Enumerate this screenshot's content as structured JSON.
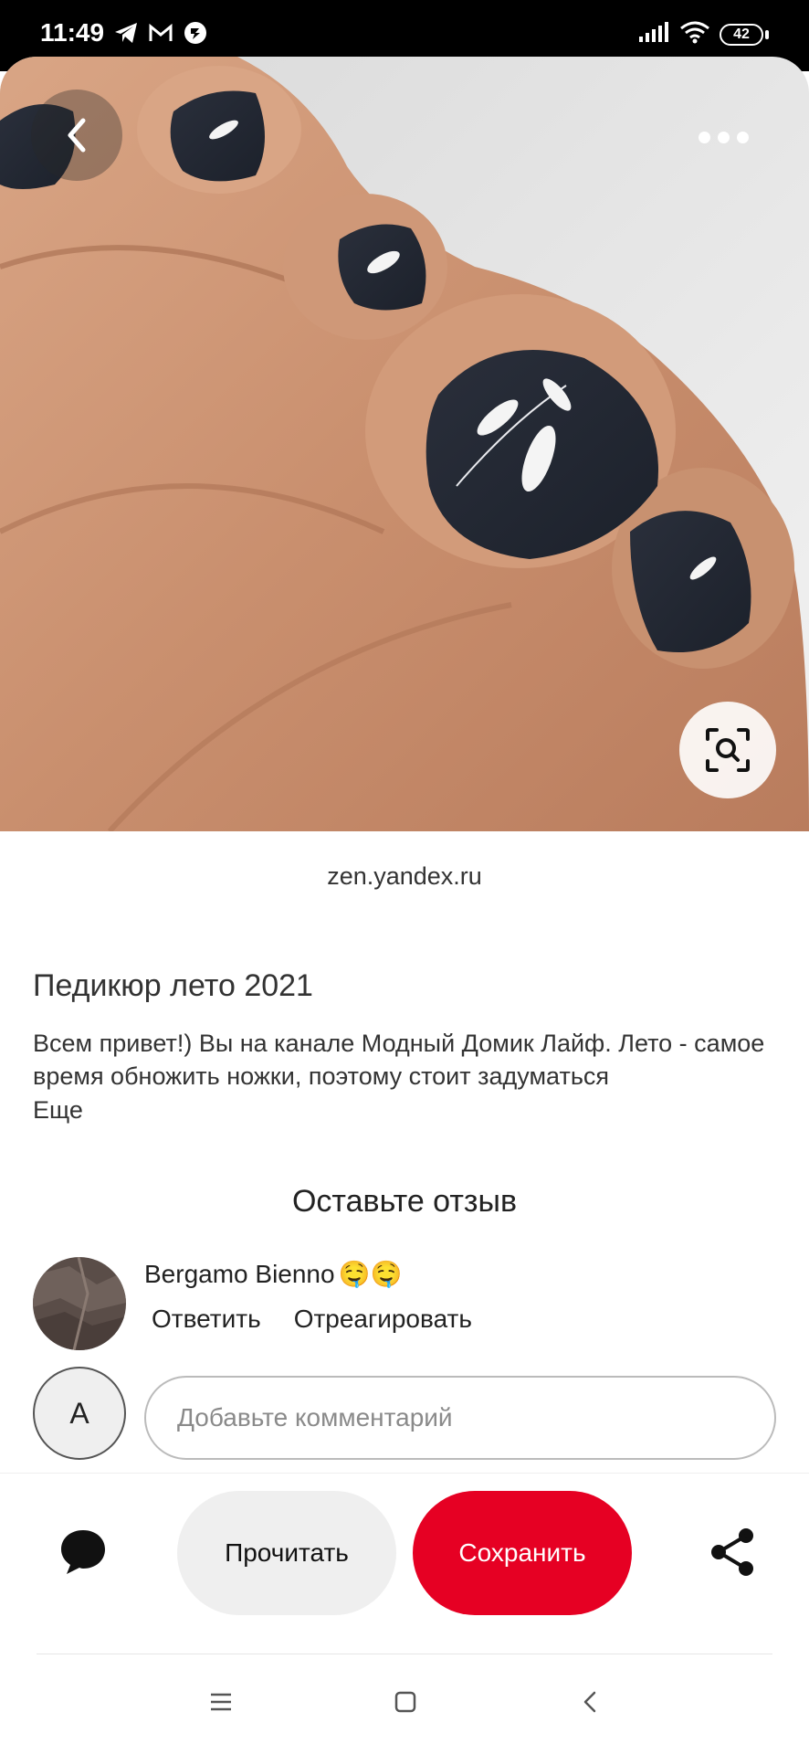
{
  "status_bar": {
    "time": "11:49",
    "left_icons": [
      "telegram-icon",
      "gmail-icon",
      "app-icon"
    ],
    "right_icons": [
      "signal-icon",
      "wifi-icon"
    ],
    "battery": "42"
  },
  "hero": {
    "image_description_icon": "pedicure-photo",
    "back_icon": "chevron-left-icon",
    "more_icon": "more-horizontal-icon",
    "lens_icon": "visual-search-icon"
  },
  "pin": {
    "source": "zen.yandex.ru",
    "title": "Педикюр лето 2021",
    "description": "Всем привет!) Вы на канале Модный Домик Лайф. Лето - самое время обножить ножки, поэтому стоит задуматься",
    "more_label": "Еще"
  },
  "comments": {
    "heading": "Оставьте отзыв",
    "items": [
      {
        "author": "Bergamo Bienno",
        "emoji": "🤤🤤",
        "reply_label": "Ответить",
        "react_label": "Отреагировать"
      }
    ],
    "user_initial": "A",
    "input_placeholder": "Добавьте комментарий"
  },
  "actions": {
    "comment_icon": "chat-bubble-icon",
    "read_label": "Прочитать",
    "save_label": "Сохранить",
    "share_icon": "share-icon"
  },
  "colors": {
    "save": "#e60023",
    "read": "#efefef",
    "status_bar": "#000000"
  },
  "nav_bar": {
    "icons": [
      "menu-icon",
      "home-icon",
      "back-icon"
    ]
  }
}
